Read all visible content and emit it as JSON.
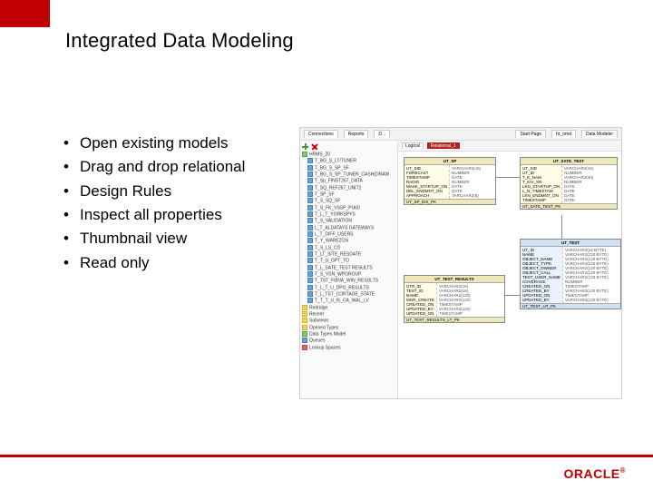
{
  "title": "Integrated Data Modeling",
  "bullets": [
    "Open existing models",
    "Drag and drop relational",
    "Design Rules",
    "Inspect all properties",
    "Thumbnail view",
    "Read only"
  ],
  "screenshot": {
    "top_tabs": [
      "Connections",
      "Reports",
      "D..."
    ],
    "right_tabs": [
      "Start Page",
      "hr_omd",
      "Data Modeler"
    ],
    "canvas_tabs": [
      "Logical",
      "Relational_1"
    ],
    "toolbar": {
      "add": "add-icon",
      "delete": "delete-icon",
      "refresh": "refresh-icon"
    },
    "tree": [
      {
        "icon": "g",
        "indent": 0,
        "label": "HRMS_20"
      },
      {
        "icon": "b",
        "indent": 1,
        "label": "T_BG_S_LT/TUNER"
      },
      {
        "icon": "b",
        "indent": 1,
        "label": "T_BG_S_SP_SF"
      },
      {
        "icon": "b",
        "indent": 1,
        "label": "T_BG_S_SP_TUNER_CASH(DRAW"
      },
      {
        "icon": "b",
        "indent": 1,
        "label": "T_Sp_FINST267_DATA"
      },
      {
        "icon": "b",
        "indent": 1,
        "label": "T_SQ_REF267_UNIT2"
      },
      {
        "icon": "b",
        "indent": 1,
        "label": "T_SP_SF"
      },
      {
        "icon": "b",
        "indent": 1,
        "label": "T_S_SQ_SF"
      },
      {
        "icon": "b",
        "indent": 1,
        "label": "T_S_FK_VSSP_PU60"
      },
      {
        "icon": "b",
        "indent": 1,
        "label": "T_L_T_YORKSPYS"
      },
      {
        "icon": "b",
        "indent": 1,
        "label": "T_S_VALIDATION"
      },
      {
        "icon": "b",
        "indent": 1,
        "label": "L_T_ALDATAYS GATEWAYS"
      },
      {
        "icon": "b",
        "indent": 1,
        "label": "L_T_DIFF_USERS"
      },
      {
        "icon": "b",
        "indent": 1,
        "label": "T_Y_WAREZCN"
      },
      {
        "icon": "b",
        "indent": 1,
        "label": "T_S_LS_CD"
      },
      {
        "icon": "b",
        "indent": 1,
        "label": "T_LT_SITE_RESDATE"
      },
      {
        "icon": "b",
        "indent": 1,
        "label": "T_T_U_GPT_TO"
      },
      {
        "icon": "b",
        "indent": 1,
        "label": "T_L_SATE_TEST RESULTS"
      },
      {
        "icon": "b",
        "indent": 1,
        "label": "T_S_VSN_WPGROUP"
      },
      {
        "icon": "b",
        "indent": 1,
        "label": "T_TST_FIBVA_WIN_RESULTS"
      },
      {
        "icon": "b",
        "indent": 1,
        "label": "T_L_T_U_DPG_RESULTS"
      },
      {
        "icon": "b",
        "indent": 1,
        "label": "T_L_TST_CORTAGE_STATE"
      },
      {
        "icon": "b",
        "indent": 1,
        "label": "T_T_T_U_I5_CA_WAL_LV"
      },
      {
        "icon": "y",
        "indent": 0,
        "label": "Redridge"
      },
      {
        "icon": "y",
        "indent": 0,
        "label": "Recent"
      },
      {
        "icon": "y",
        "indent": 0,
        "label": "Subviews"
      },
      {
        "icon": "y",
        "indent": 0,
        "label": "Opened Types"
      },
      {
        "icon": "g",
        "indent": 0,
        "label": "Data Types Model"
      },
      {
        "icon": "b",
        "indent": 0,
        "label": "Queues"
      },
      {
        "icon": "r",
        "indent": 0,
        "label": "Lookup Spaces"
      }
    ],
    "entities": [
      {
        "id": "ut_sp",
        "header": "UT_SP",
        "style": "yellow",
        "left_cols": [
          "UT_SID",
          "FORECAST",
          "TIMESTAMP",
          "RADIO",
          "MASK_STARTUP_ON",
          "DEL_ENDMNT_ON",
          "APPROACH"
        ],
        "right_cols": [
          "VARCHAR2(16)",
          "NUMBER",
          "DATE",
          "NUMBER",
          "DATE",
          "DATE",
          "VARCHAR2(8)"
        ],
        "footer": "UT_SP_IDX_PK"
      },
      {
        "id": "ut_sate_test",
        "header": "UT_SATE_TEST",
        "style": "yellow",
        "left_cols": [
          "UT_SID",
          "UT_ID",
          "T_K_NAM",
          "T_KIV_SR",
          "LKN_STARTUP_ON",
          "L_N_TIMESTAM",
          "LKN_ENDMNT_ON",
          "TIMESTAMP"
        ],
        "right_cols": [
          "VARCHAR2(16)",
          "NUMBER",
          "VARCHAR2(40)",
          "NUMBER",
          "DATE",
          "DATE",
          "DATE",
          "DATE"
        ],
        "footer": "UT_SATE_TEST_PK"
      },
      {
        "id": "ut_test_results",
        "header": "UT_TEST_RESULTS",
        "style": "yellow",
        "left_cols": [
          "UTR_ID",
          "TEST_ID",
          "NAME",
          "MGR_CREATE",
          "CREATED_ON",
          "UPDATED_BY",
          "UPDATED_ON"
        ],
        "right_cols": [
          "VARCHAR2(16)",
          "VARCHAR2(16)",
          "VARCHAR2(120)",
          "VARCHAR2(120)",
          "TIMESTAMP",
          "VARCHAR2(120)",
          "TIMESTAMP"
        ],
        "footer": "UT_TEST_RESULTS_LT_PK"
      },
      {
        "id": "ut_test",
        "header": "UT_TEST",
        "style": "blue",
        "left_cols": [
          "UT_ID",
          "NAME",
          "OBJECT_NAME",
          "OBJECT_TYPE",
          "OBJECT_OWNER",
          "OBJECT_CALL",
          "TEST_USER_NAME",
          "COVERAGE",
          "CREATED_ON",
          "CREATED_BY",
          "UPDATED_ON",
          "UPDATED_BY"
        ],
        "right_cols": [
          "VARCHAR2(16 BYTE)",
          "VARCHAR2(120 BYTE)",
          "VARCHAR2(120 BYTE)",
          "VARCHAR2(120 BYTE)",
          "VARCHAR2(120 BYTE)",
          "VARCHAR2(120 BYTE)",
          "VARCHAR2(120 BYTE)",
          "NUMBER",
          "TIMESTAMP",
          "VARCHAR2(120 BYTE)",
          "TIMESTAMP",
          "VARCHAR2(120 BYTE)"
        ],
        "footer": "UT_TEST_UT_PK"
      }
    ]
  },
  "logo": "ORACLE"
}
